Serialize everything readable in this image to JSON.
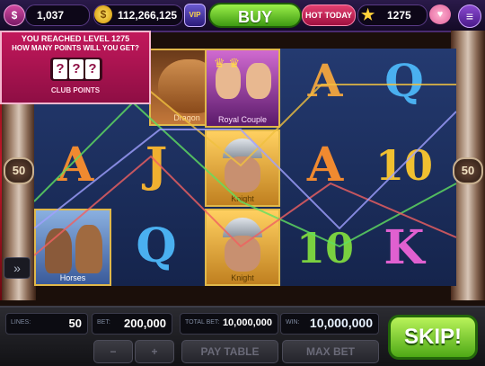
{
  "topbar": {
    "level_badge": "1,037",
    "coins": "112,266,125",
    "buy_label": "BUY",
    "hot_today_label": "HOT TODAY",
    "stars": "1275"
  },
  "popup": {
    "line1": "YOU REACHED LEVEL 1275",
    "line2": "HOW MANY POINTS WILL YOU GET?",
    "club_points_label": "CLUB POINTS",
    "digits": [
      "?",
      "?",
      "?"
    ]
  },
  "reels": {
    "left_line_count": "50",
    "right_line_count": "50",
    "row1": [
      "Dragon",
      "Royal Couple",
      "A",
      "Q"
    ],
    "row2": [
      "A",
      "J",
      "Knight",
      "A",
      "10"
    ],
    "row3": [
      "Horses",
      "Q",
      "Knight",
      "10",
      "K"
    ]
  },
  "bottom": {
    "lines_label": "LINES:",
    "lines_value": "50",
    "bet_label": "BET:",
    "bet_value": "200,000",
    "total_bet_label": "TOTAL BET:",
    "total_bet_value": "10,000,000",
    "win_label": "WIN:",
    "win_value": "10,000,000",
    "minus_label": "−",
    "plus_label": "+",
    "paytable_label": "PAY TABLE",
    "maxbet_label": "MAX BET",
    "skip_label": "SKIP!"
  },
  "colors": {
    "accent_green": "#4ea916",
    "popup_pink": "#c2185b",
    "gold": "#e0b84a"
  }
}
